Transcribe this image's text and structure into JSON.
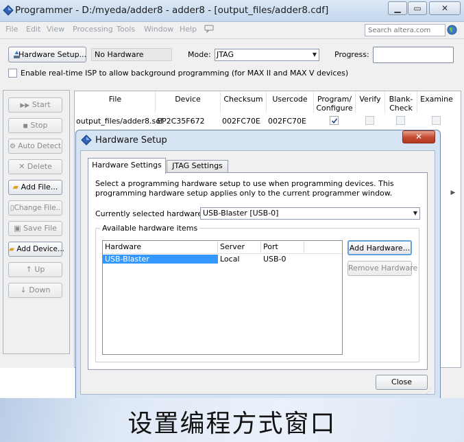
{
  "window": {
    "title": "Programmer - D:/myeda/adder8 - adder8 - [output_files/adder8.cdf]",
    "minimize": "▁",
    "maximize": "▭",
    "close": "✕"
  },
  "menu": {
    "items": [
      "File",
      "Edit",
      "View",
      "Processing",
      "Tools",
      "Window",
      "Help"
    ],
    "search_placeholder": "Search altera.com"
  },
  "toolbar": {
    "hardware_setup_label": "Hardware Setup...",
    "hardware_status": "No Hardware",
    "mode_label": "Mode:",
    "mode_value": "JTAG",
    "progress_label": "Progress:",
    "isp_label": "Enable real-time ISP to allow background programming (for MAX II and MAX V devices)"
  },
  "side_buttons": [
    {
      "label": "Start",
      "enabled": false
    },
    {
      "label": "Stop",
      "enabled": false
    },
    {
      "label": "Auto Detect",
      "enabled": false
    },
    {
      "label": "Delete",
      "enabled": false
    },
    {
      "label": "Add File...",
      "enabled": true
    },
    {
      "label": "Change File..",
      "enabled": false
    },
    {
      "label": "Save File",
      "enabled": false
    },
    {
      "label": "Add Device...",
      "enabled": true
    },
    {
      "label": "Up",
      "enabled": false
    },
    {
      "label": "Down",
      "enabled": false
    }
  ],
  "file_table": {
    "headers": [
      "File",
      "Device",
      "Checksum",
      "Usercode",
      "Program/\nConfigure",
      "Verify",
      "Blank-\nCheck",
      "Examine"
    ],
    "rows": [
      {
        "file": "output_files/adder8.sof",
        "device": "EP2C35F672",
        "checksum": "002FC70E",
        "usercode": "002FC70E",
        "program": true,
        "verify": false,
        "blank": false,
        "examine": false
      }
    ]
  },
  "dialog": {
    "title": "Hardware Setup",
    "tabs": [
      "Hardware Settings",
      "JTAG Settings"
    ],
    "intro": "Select a programming hardware setup to use when programming devices. This programming hardware setup applies only to the current programmer window.",
    "current_label": "Currently selected hardware:",
    "current_value": "USB-Blaster [USB-0]",
    "group_label": "Available hardware items",
    "list_headers": [
      "Hardware",
      "Server",
      "Port"
    ],
    "list_rows": [
      {
        "hardware": "USB-Blaster",
        "server": "Local",
        "port": "USB-0"
      }
    ],
    "add_button": "Add Hardware...",
    "remove_button": "Remove Hardware",
    "close_button": "Close"
  },
  "caption": "设置编程方式窗口",
  "colors": {
    "selection": "#3399ff",
    "close_red": "#c24a2e",
    "title_bar": "#c4d7ee"
  }
}
